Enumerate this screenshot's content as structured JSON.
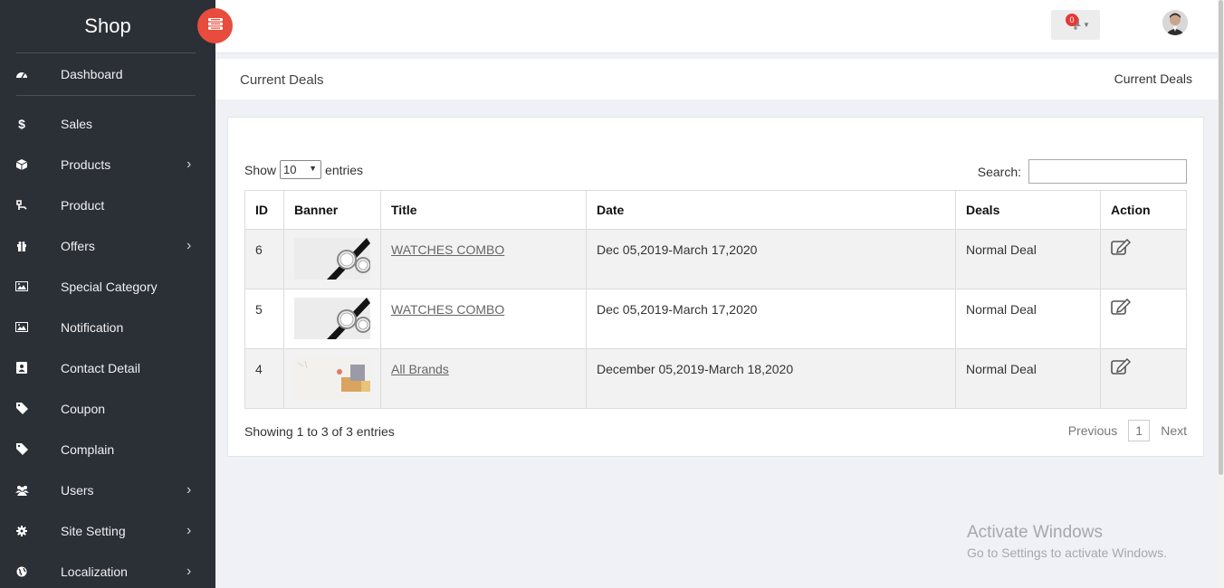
{
  "app": {
    "brand": "Shop"
  },
  "sidebar": {
    "items": [
      {
        "label": "Dashboard",
        "icon": "dashboard-icon",
        "has_children": false
      },
      {
        "label": "Sales",
        "icon": "dollar-icon",
        "has_children": false
      },
      {
        "label": "Products",
        "icon": "cube-icon",
        "has_children": true
      },
      {
        "label": "Product",
        "icon": "product-icon",
        "has_children": false
      },
      {
        "label": "Offers",
        "icon": "gift-icon",
        "has_children": true
      },
      {
        "label": "Special Category",
        "icon": "image-icon",
        "has_children": false
      },
      {
        "label": "Notification",
        "icon": "image-icon",
        "has_children": false
      },
      {
        "label": "Contact Detail",
        "icon": "contact-card-icon",
        "has_children": false
      },
      {
        "label": "Coupon",
        "icon": "tag-icon",
        "has_children": false
      },
      {
        "label": "Complain",
        "icon": "tag-icon",
        "has_children": false
      },
      {
        "label": "Users",
        "icon": "users-icon",
        "has_children": true
      },
      {
        "label": "Site Setting",
        "icon": "gear-icon",
        "has_children": true
      },
      {
        "label": "Localization",
        "icon": "globe-icon",
        "has_children": true
      }
    ]
  },
  "topbar": {
    "notification_count": "0"
  },
  "page": {
    "title": "Current Deals",
    "breadcrumb": "Current Deals"
  },
  "datatable": {
    "show_label": "Show",
    "entries_value": "10",
    "entries_label": "entries",
    "search_label": "Search:",
    "search_value": "",
    "columns": [
      "ID",
      "Banner",
      "Title",
      "Date",
      "Deals",
      "Action"
    ],
    "rows": [
      {
        "id": "6",
        "banner": "watches-banner",
        "title": "WATCHES COMBO",
        "date": "Dec 05,2019-March 17,2020",
        "deals": "Normal Deal"
      },
      {
        "id": "5",
        "banner": "watches-banner",
        "title": "WATCHES COMBO",
        "date": "Dec 05,2019-March 17,2020",
        "deals": "Normal Deal"
      },
      {
        "id": "4",
        "banner": "brands-banner",
        "title": "All Brands",
        "date": "December 05,2019-March 18,2020",
        "deals": "Normal Deal"
      }
    ],
    "info": "Showing 1 to 3 of 3 entries",
    "pagination": {
      "previous": "Previous",
      "current": "1",
      "next": "Next"
    }
  },
  "watermark": {
    "line1": "Activate Windows",
    "line2": "Go to Settings to activate Windows."
  },
  "colors": {
    "sidebar_bg": "#2b2f36",
    "toggle_bg": "#e74c3c",
    "badge_bg": "#e53935",
    "page_bg": "#eff1f6"
  }
}
